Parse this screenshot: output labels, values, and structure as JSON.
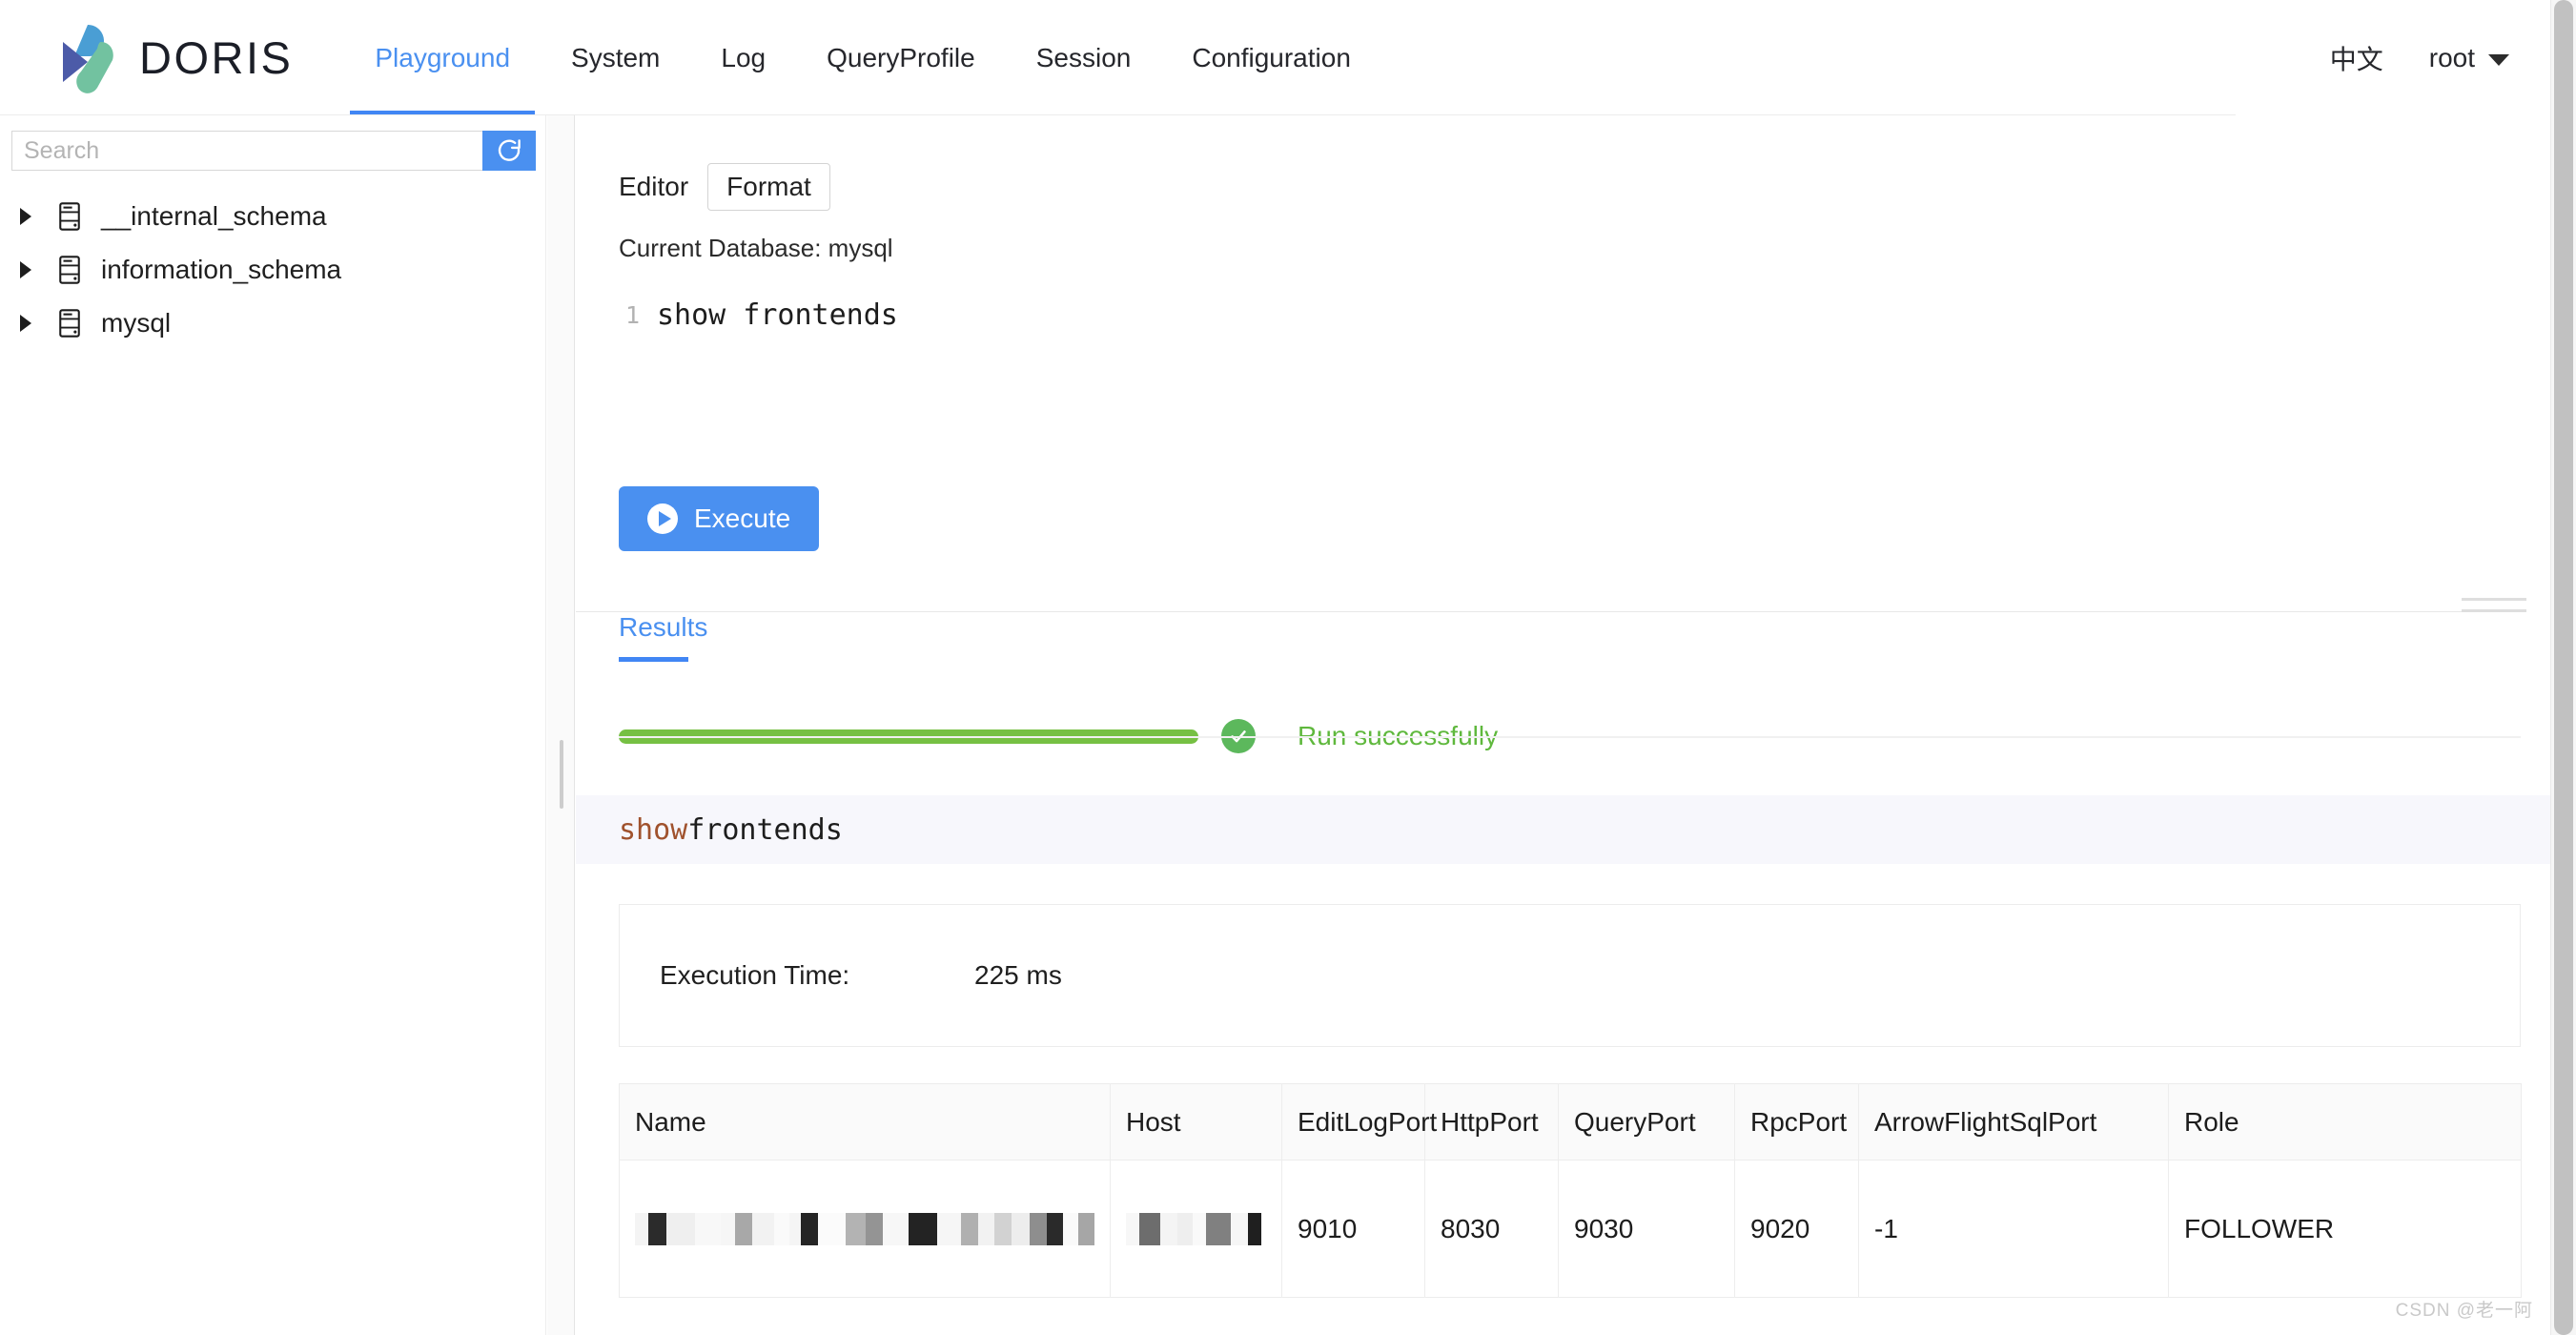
{
  "header": {
    "brand": "DORIS",
    "logo_icon": "doris-logo-icon",
    "nav": [
      {
        "label": "Playground",
        "active": true
      },
      {
        "label": "System",
        "active": false
      },
      {
        "label": "Log",
        "active": false
      },
      {
        "label": "QueryProfile",
        "active": false
      },
      {
        "label": "Session",
        "active": false
      },
      {
        "label": "Configuration",
        "active": false
      }
    ],
    "lang_label": "中文",
    "user_label": "root",
    "caret_icon": "chevron-down-icon"
  },
  "sidebar": {
    "search_placeholder": "Search",
    "search_value": "",
    "refresh_icon": "refresh-icon",
    "tree": [
      {
        "label": "__internal_schema",
        "icon": "database-icon",
        "arrow": "chevron-right-icon"
      },
      {
        "label": "information_schema",
        "icon": "database-icon",
        "arrow": "chevron-right-icon"
      },
      {
        "label": "mysql",
        "icon": "database-icon",
        "arrow": "chevron-right-icon"
      }
    ]
  },
  "editor": {
    "label": "Editor",
    "format_label": "Format",
    "current_database": "Current Database: mysql",
    "line_number": "1",
    "code": "show frontends",
    "execute_label": "Execute",
    "play_icon": "play-icon"
  },
  "results": {
    "tab_label": "Results",
    "status_text": "Run successfully",
    "status_icon": "check-circle-icon",
    "progress_percent": 100,
    "progress_color": "#76c043",
    "sql_keyword": "show",
    "sql_rest": " frontends",
    "execution_time_label": "Execution Time:",
    "execution_time_value": "225 ms",
    "columns": [
      "Name",
      "Host",
      "EditLogPort",
      "HttpPort",
      "QueryPort",
      "RpcPort",
      "ArrowFlightSqlPort",
      "Role"
    ],
    "rows": [
      {
        "Name": "",
        "Host": "",
        "EditLogPort": "9010",
        "HttpPort": "8030",
        "QueryPort": "9030",
        "RpcPort": "9020",
        "ArrowFlightSqlPort": "-1",
        "Role": "FOLLOWER"
      }
    ]
  },
  "watermark": "CSDN @老一阿",
  "accent_color": "#4a90f0",
  "success_color": "#5fb83d"
}
